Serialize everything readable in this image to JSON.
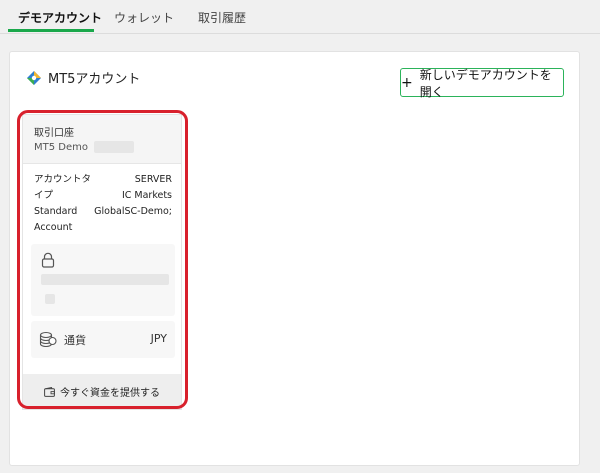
{
  "tabs": [
    {
      "label": "デモアカウント"
    },
    {
      "label": "ウォレット"
    },
    {
      "label": "取引履歴"
    }
  ],
  "header": {
    "title": "MT5アカウント",
    "new_button": "新しいデモアカウントを開く",
    "plus": "+"
  },
  "card": {
    "account_label": "取引口座",
    "account_name": "MT5 Demo",
    "type_label": "アカウントタイプ",
    "type_value": "Standard Account",
    "server_label": "SERVER",
    "server_value": "IC Markets GlobalSC-Demo;",
    "currency_label": "通貨",
    "currency_value": "JPY",
    "fund_button": "今すぐ資金を提供する"
  },
  "colors": {
    "accent": "#1aa84b",
    "highlight": "#d8202c"
  },
  "icons": [
    "mt5-logo-icon",
    "lock-icon",
    "coins-icon",
    "wallet-icon"
  ]
}
